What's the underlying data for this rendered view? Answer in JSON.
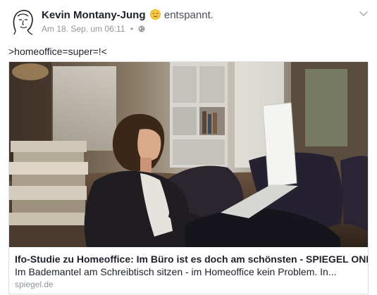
{
  "post": {
    "author": "Kevin Montany-Jung",
    "feeling": "entspannt.",
    "timestamp": "Am 18. Sep. um 06:11",
    "separator": "•",
    "audience_icon": "globe-icon",
    "options_icon": "chevron-down-icon",
    "text": ">homeoffice=super=!<"
  },
  "link_preview": {
    "title": "Ifo-Studie zu Homeoffice: Im Büro ist es doch am schönsten - SPIEGEL ONLINE",
    "description": "Im Bademantel am Schreibtisch sitzen - im Homeoffice kein Problem. In...",
    "domain": "spiegel.de"
  },
  "colors": {
    "primary_text": "#1d2129",
    "secondary_text": "#90949c",
    "card_border": "#dddfe2"
  }
}
